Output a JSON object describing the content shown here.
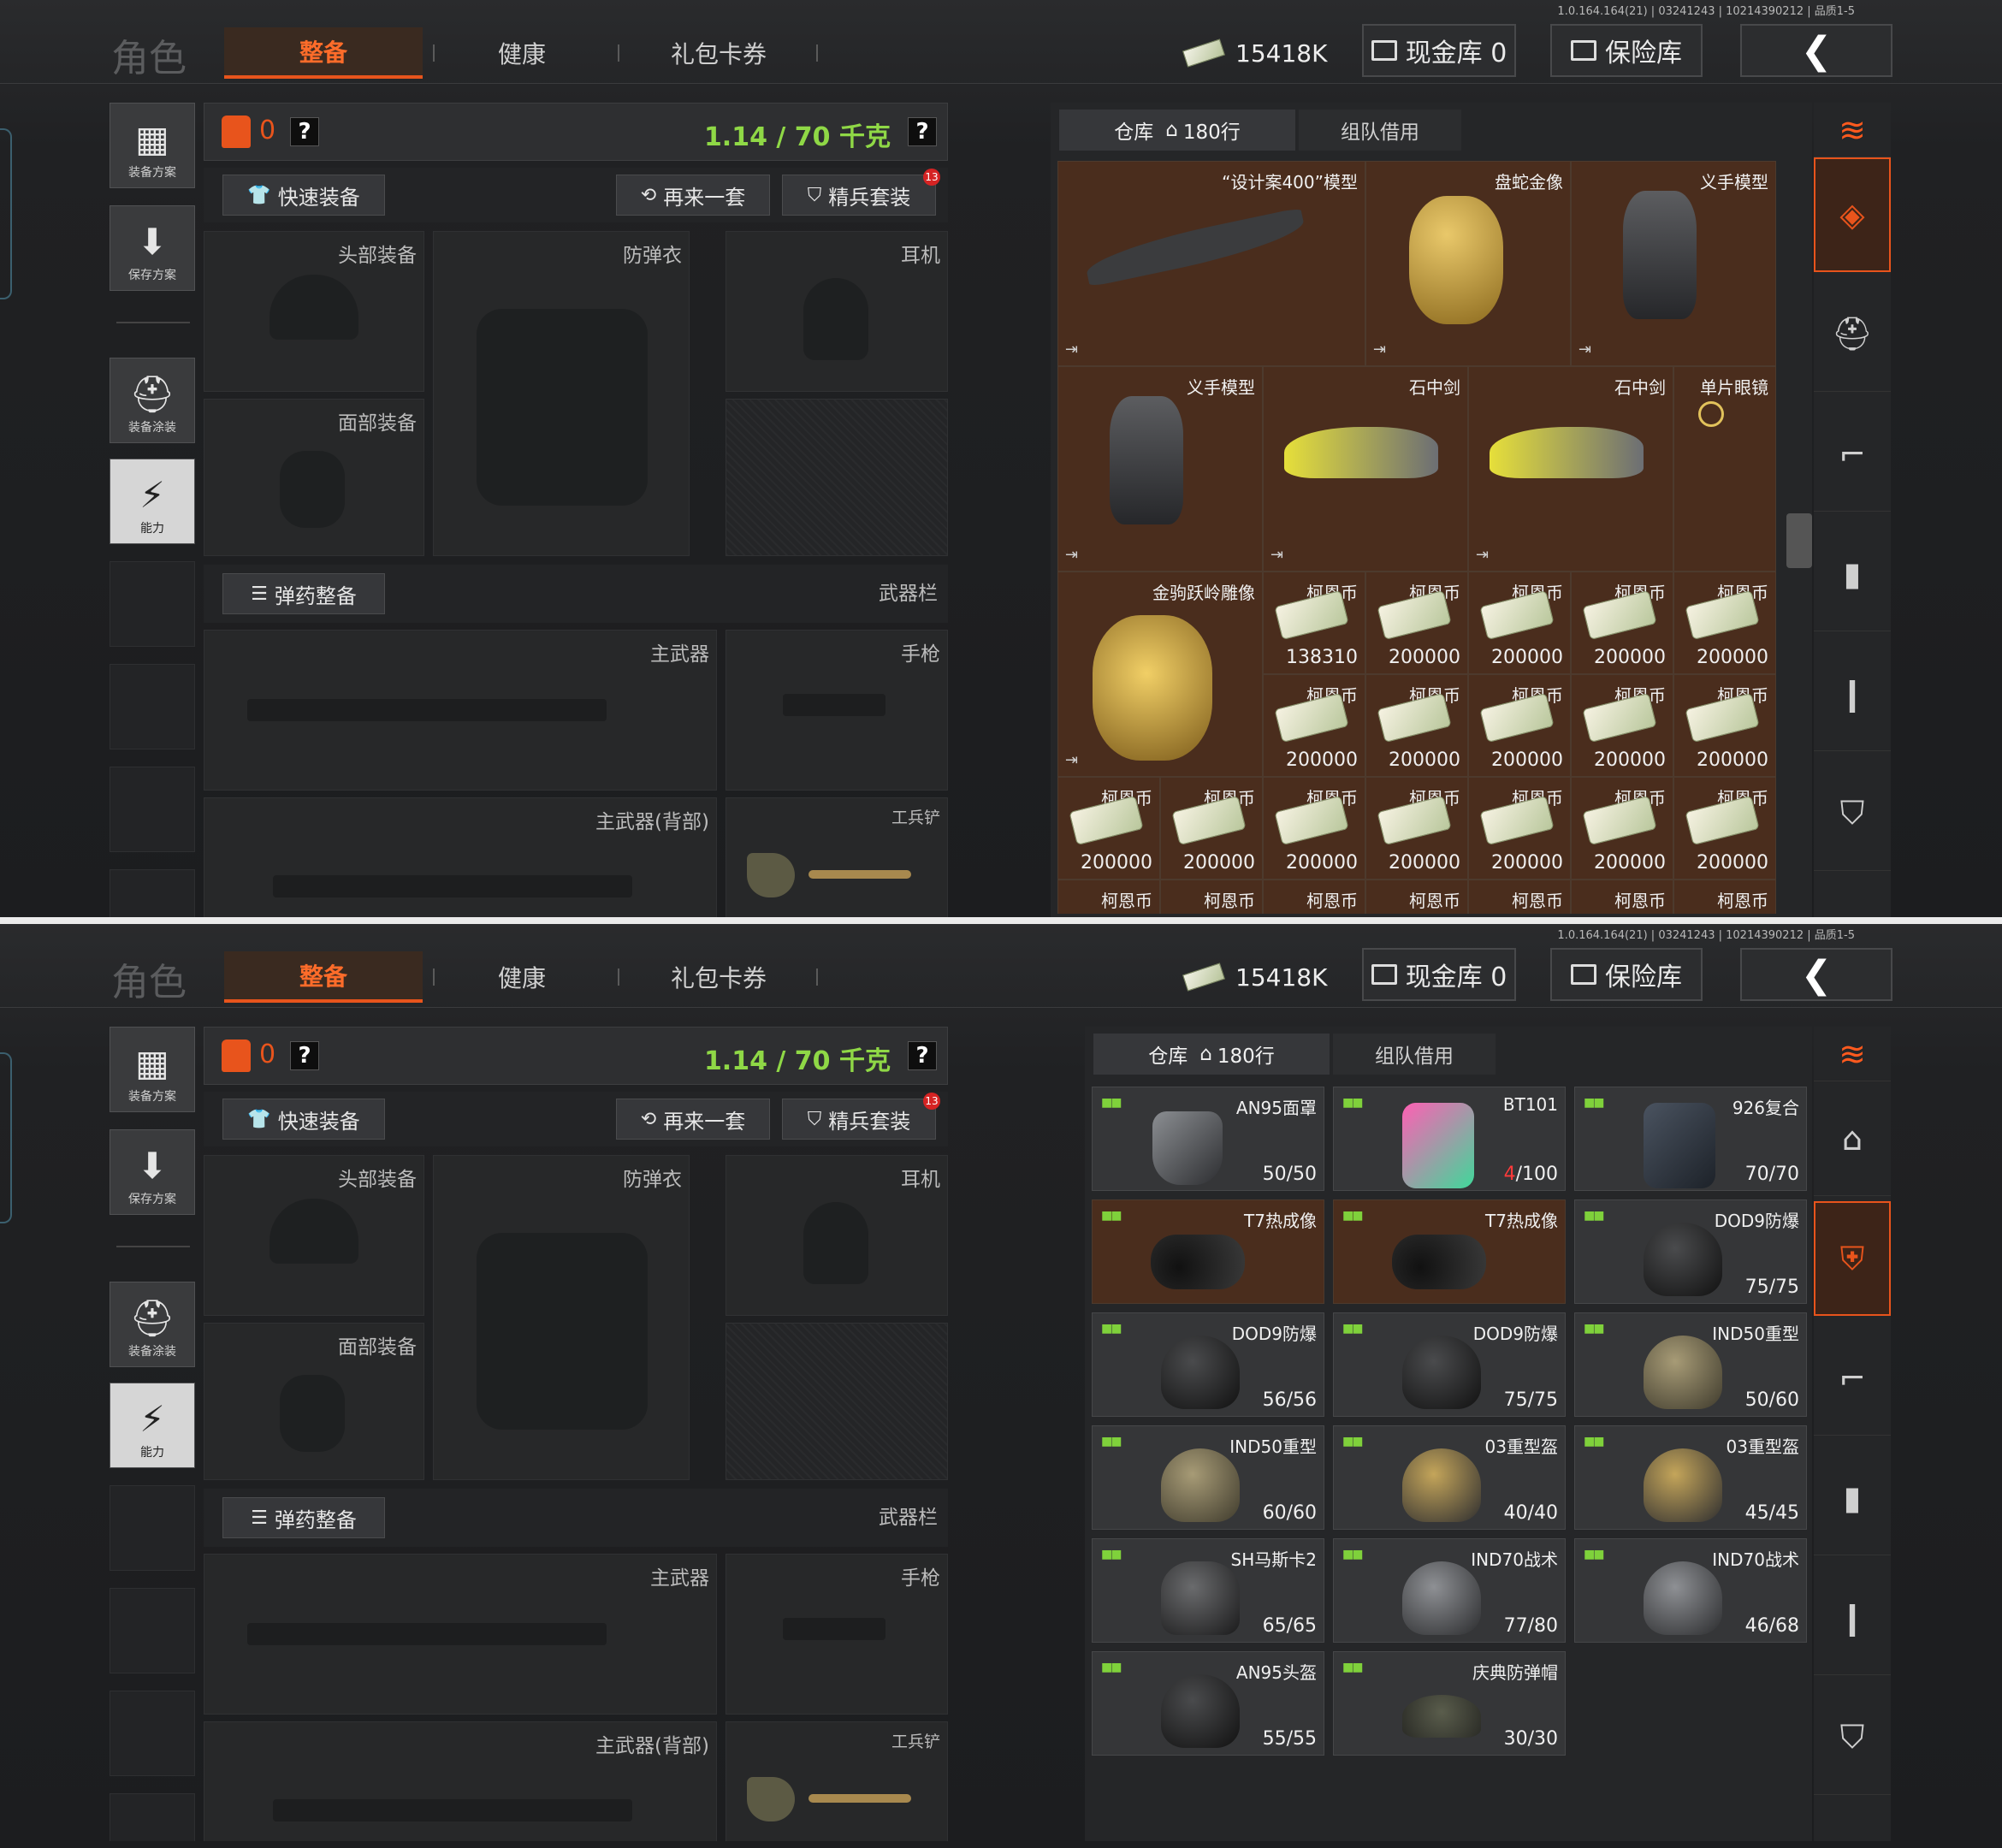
{
  "version": "1.0.164.164(21) | 03241243 | 10214390212 | 品质1-5",
  "header": {
    "role_label": "角色",
    "tabs": [
      "整备",
      "健康",
      "礼包卡券"
    ],
    "money": "15418K",
    "cash_vault_label": "现金库 0",
    "safe_label": "保险库",
    "back_glyph": "❮"
  },
  "left_nav": [
    {
      "label": "装备方案",
      "icon": "equipment-plan-icon"
    },
    {
      "label": "保存方案",
      "icon": "download-icon"
    },
    {
      "label": "装备涂装",
      "icon": "helmet-paint-icon"
    },
    {
      "label": "能力",
      "icon": "ability-bolt-icon"
    }
  ],
  "loadout": {
    "armor_count": "0",
    "weight": "1.14 / 70 千克",
    "help": "?",
    "quick_equip": "快速装备",
    "again": "再来一套",
    "elite": "精兵套装",
    "elite_badge": "13",
    "slots": {
      "head": "头部装备",
      "armor": "防弹衣",
      "ear": "耳机",
      "face": "面部装备",
      "ammo": "弹药整备",
      "weapons": "武器栏",
      "primary": "主武器",
      "pistol": "手枪",
      "primary_back": "主武器(背部)",
      "shovel": "工兵铲"
    }
  },
  "inventory": {
    "tab_warehouse": "仓库",
    "tab_rows": "180行",
    "tab_team": "组队借用"
  },
  "warehouse_top": [
    {
      "name": "“设计案400”模型",
      "art": "jet"
    },
    {
      "name": "盘蛇金像",
      "art": "snake"
    },
    {
      "name": "义手模型",
      "art": "hand"
    },
    {
      "name": "义手模型",
      "art": "hand"
    },
    {
      "name": "石中剑",
      "art": "car"
    },
    {
      "name": "石中剑",
      "art": "car"
    },
    {
      "name": "单片眼镜",
      "art": "monocle"
    },
    {
      "name": "金驹跃岭雕像",
      "art": "horse"
    }
  ],
  "coins": {
    "name": "柯恩币",
    "row1": [
      "138310",
      "200000",
      "200000",
      "200000",
      "200000"
    ],
    "row2": [
      "200000",
      "200000",
      "200000",
      "200000",
      "200000"
    ],
    "row3": [
      "200000",
      "200000",
      "200000",
      "200000",
      "200000",
      "200000",
      "200000"
    ]
  },
  "gear_list": [
    {
      "name": "AN95面罩",
      "qty": "50/50",
      "art": "visor",
      "style": "dark"
    },
    {
      "name": "BT101",
      "qty_red": "4",
      "qty": "/100",
      "art": "vest-pink",
      "style": "dark"
    },
    {
      "name": "926复合",
      "qty": "70/70",
      "art": "vest-dark",
      "style": "dark"
    },
    {
      "name": "T7热成像",
      "qty": "",
      "art": "nvg",
      "style": "gold"
    },
    {
      "name": "T7热成像",
      "qty": "",
      "art": "nvg",
      "style": "gold"
    },
    {
      "name": "DOD9防爆",
      "qty": "75/75",
      "art": "helmet-black",
      "style": "dark"
    },
    {
      "name": "DOD9防爆",
      "qty": "56/56",
      "art": "helmet-black",
      "style": "dark"
    },
    {
      "name": "DOD9防爆",
      "qty": "75/75",
      "art": "helmet-black",
      "style": "dark"
    },
    {
      "name": "IND50重型",
      "qty": "50/60",
      "art": "helmet-tan",
      "style": "dark"
    },
    {
      "name": "IND50重型",
      "qty": "60/60",
      "art": "helmet-tan",
      "style": "dark"
    },
    {
      "name": "03重型盔",
      "qty": "40/40",
      "art": "helmet-gold",
      "style": "dark"
    },
    {
      "name": "03重型盔",
      "qty": "45/45",
      "art": "helmet-gold",
      "style": "dark"
    },
    {
      "name": "SH马斯卡2",
      "qty": "65/65",
      "art": "helmet-mask",
      "style": "dark"
    },
    {
      "name": "IND70战术",
      "qty": "77/80",
      "art": "helmet-grey",
      "style": "dark"
    },
    {
      "name": "IND70战术",
      "qty": "46/68",
      "art": "helmet-grey",
      "style": "dark"
    },
    {
      "name": "AN95头盔",
      "qty": "55/55",
      "art": "helmet-black",
      "style": "dark"
    },
    {
      "name": "庆典防弹帽",
      "qty": "30/30",
      "art": "cap",
      "style": "dark"
    }
  ],
  "colors": {
    "accent": "#e8541c",
    "weight": "#8fd846",
    "gold_cell": "#4a2d1d"
  }
}
